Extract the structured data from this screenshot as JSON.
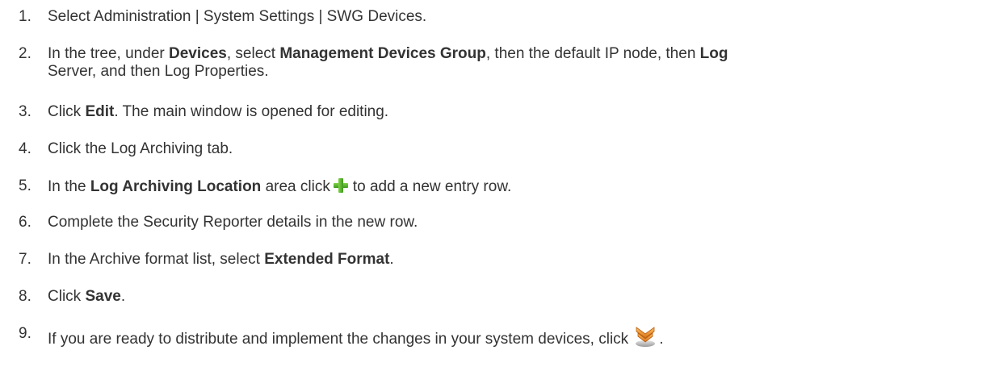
{
  "steps": [
    {
      "number": "1.",
      "parts": [
        "Select Administration | System Settings | SWG Devices."
      ]
    },
    {
      "number": "2.",
      "parts": [
        "In the tree, under ",
        "Devices",
        ", select ",
        "Management Devices Group",
        ", then the default IP node, then ",
        "Log",
        " Server, and then Log Properties."
      ]
    },
    {
      "number": "3.",
      "parts": [
        "Click ",
        "Edit",
        ". The main window is opened for editing."
      ]
    },
    {
      "number": "4.",
      "parts": [
        "Click the Log Archiving tab."
      ]
    },
    {
      "number": "5.",
      "parts": [
        "In the ",
        "Log Archiving Location",
        " area click",
        "to add a new entry row."
      ]
    },
    {
      "number": "6.",
      "parts": [
        "Complete the Security Reporter details in the new row."
      ]
    },
    {
      "number": "7.",
      "parts": [
        "In the Archive format list, select ",
        "Extended Format",
        "."
      ]
    },
    {
      "number": "8.",
      "parts": [
        "Click ",
        "Save",
        "."
      ]
    },
    {
      "number": "9.",
      "parts": [
        "If you are ready to distribute and implement the changes in your system devices, click",
        "."
      ]
    }
  ],
  "icons": {
    "add": "plus-icon",
    "distribute": "distribute-icon"
  },
  "colors": {
    "text": "#333333",
    "plus_green": "#4caf26",
    "distribute_orange": "#e8922a"
  }
}
